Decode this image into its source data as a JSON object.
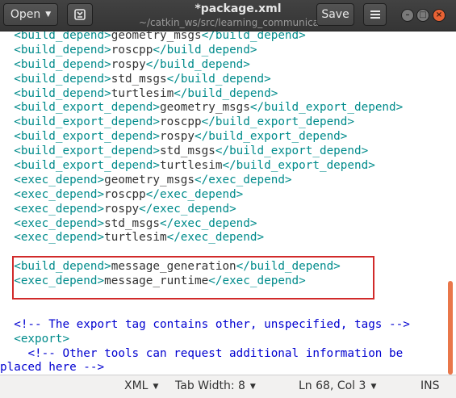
{
  "header": {
    "open_label": "Open",
    "title": "*package.xml",
    "subtitle": "~/catkin_ws/src/learning_communication",
    "save_label": "Save",
    "icons": {
      "open_dropdown": "chevron-down-icon",
      "favorite": "bookmark-new-icon",
      "menu": "hamburger-menu-icon",
      "minimize": "window-minimize-icon",
      "maximize": "window-maximize-icon",
      "close": "window-close-icon"
    }
  },
  "editor": {
    "lines": [
      {
        "indent": "  ",
        "open": "<build_depend>",
        "text": "geometry_msgs",
        "close": "</build_depend>"
      },
      {
        "indent": "  ",
        "open": "<build_depend>",
        "text": "roscpp",
        "close": "</build_depend>"
      },
      {
        "indent": "  ",
        "open": "<build_depend>",
        "text": "rospy",
        "close": "</build_depend>"
      },
      {
        "indent": "  ",
        "open": "<build_depend>",
        "text": "std_msgs",
        "close": "</build_depend>"
      },
      {
        "indent": "  ",
        "open": "<build_depend>",
        "text": "turtlesim",
        "close": "</build_depend>"
      },
      {
        "indent": "  ",
        "open": "<build_export_depend>",
        "text": "geometry_msgs",
        "close": "</build_export_depend>"
      },
      {
        "indent": "  ",
        "open": "<build_export_depend>",
        "text": "roscpp",
        "close": "</build_export_depend>"
      },
      {
        "indent": "  ",
        "open": "<build_export_depend>",
        "text": "rospy",
        "close": "</build_export_depend>"
      },
      {
        "indent": "  ",
        "open": "<build_export_depend>",
        "text": "std_msgs",
        "close": "</build_export_depend>"
      },
      {
        "indent": "  ",
        "open": "<build_export_depend>",
        "text": "turtlesim",
        "close": "</build_export_depend>"
      },
      {
        "indent": "  ",
        "open": "<exec_depend>",
        "text": "geometry_msgs",
        "close": "</exec_depend>"
      },
      {
        "indent": "  ",
        "open": "<exec_depend>",
        "text": "roscpp",
        "close": "</exec_depend>"
      },
      {
        "indent": "  ",
        "open": "<exec_depend>",
        "text": "rospy",
        "close": "</exec_depend>"
      },
      {
        "indent": "  ",
        "open": "<exec_depend>",
        "text": "std_msgs",
        "close": "</exec_depend>"
      },
      {
        "indent": "  ",
        "open": "<exec_depend>",
        "text": "turtlesim",
        "close": "</exec_depend>"
      },
      {
        "indent": "",
        "open": "",
        "text": "",
        "close": ""
      },
      {
        "indent": "  ",
        "open": "<build_depend>",
        "text": "message_generation",
        "close": "</build_depend>"
      },
      {
        "indent": "  ",
        "open": "<exec_depend>",
        "text": "message_runtime",
        "close": "</exec_depend>"
      },
      {
        "indent": "",
        "open": "",
        "text": "",
        "close": ""
      },
      {
        "indent": "",
        "open": "",
        "text": "",
        "close": ""
      },
      {
        "indent": "  ",
        "comment": "<!-- The export tag contains other, unspecified, tags -->"
      },
      {
        "indent": "  ",
        "open": "<export>",
        "text": "",
        "close": ""
      },
      {
        "indent": "    ",
        "comment": "<!-- Other tools can request additional information be"
      },
      {
        "indent": "",
        "comment": "placed here -->"
      }
    ],
    "colors": {
      "tag": "#008b8b",
      "comment": "#0000d0",
      "text": "#333333",
      "highlight_box": "#d12a2a",
      "scrollbar": "#e9774a"
    }
  },
  "statusbar": {
    "language": "XML",
    "tab_width": "Tab Width: 8",
    "position": "Ln 68, Col 3",
    "mode": "INS"
  }
}
